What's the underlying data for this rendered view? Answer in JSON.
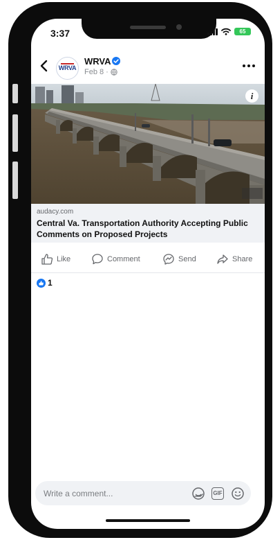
{
  "status_bar": {
    "time": "3:37",
    "battery": "65"
  },
  "post": {
    "page_name": "WRVA",
    "avatar_text": "WRVA",
    "date": "Feb 8",
    "separator": "·"
  },
  "link_preview": {
    "domain": "audacy.com",
    "title": "Central Va. Transportation Authority Accepting Public Comments on Proposed Projects"
  },
  "actions": {
    "like": "Like",
    "comment": "Comment",
    "send": "Send",
    "share": "Share"
  },
  "reactions": {
    "count": "1"
  },
  "comment_box": {
    "placeholder": "Write a comment...",
    "gif_label": "GIF"
  },
  "colors": {
    "accent": "#1877f2",
    "battery": "#34c759",
    "icon_gray": "#65676b",
    "card_bg": "#f0f2f5"
  },
  "icons": [
    "chevron-left-icon",
    "verified-icon",
    "globe-icon",
    "more-icon",
    "info-icon",
    "like-icon",
    "comment-icon",
    "messenger-icon",
    "share-icon",
    "sticker-icon",
    "gif-icon",
    "emoji-icon"
  ]
}
